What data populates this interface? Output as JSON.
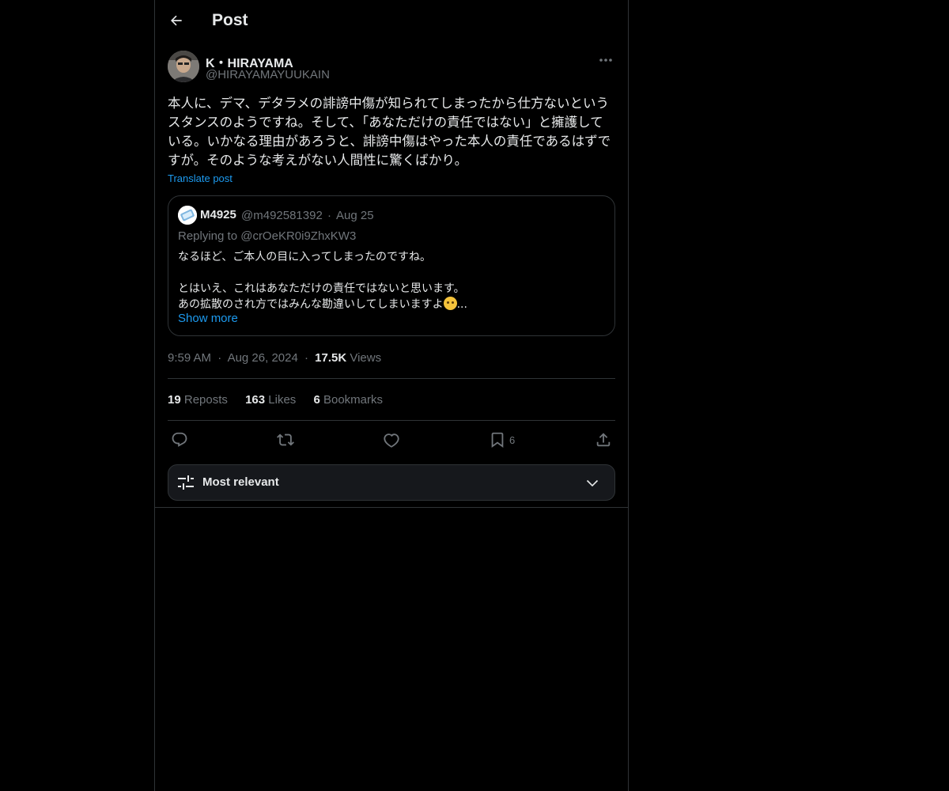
{
  "header": {
    "title": "Post"
  },
  "post": {
    "author_name": "K・HIRAYAMA",
    "author_handle": "@HIRAYAMAYUUKAIN",
    "text": "本人に、デマ、デタラメの誹謗中傷が知られてしまったから仕方ないというスタンスのようですね。そして、「あなただけの責任ではない」と擁護している。いかなる理由があろうと、誹謗中傷はやった本人の責任であるはずですが。そのような考えがない人間性に驚くばかり。",
    "translate_label": "Translate post",
    "time": "9:59 AM",
    "date": "Aug 26, 2024",
    "views_count": "17.5K",
    "views_label": "Views",
    "separator": "·"
  },
  "quote": {
    "name": "M4925",
    "handle": "@m492581392",
    "separator": "·",
    "date": "Aug 25",
    "replying_to": "Replying to @crOeKR0i9ZhxKW3",
    "line1": "なるほど、ご本人の目に入ってしまったのですね。",
    "line2": "とはいえ、これはあなただけの責任ではないと思います。",
    "line3": "あの拡散のされ方ではみんな勘違いしてしまいますよ",
    "line3_tail": "...",
    "show_more": "Show more"
  },
  "stats": {
    "reposts_count": "19",
    "reposts_label": "Reposts",
    "likes_count": "163",
    "likes_label": "Likes",
    "bookmarks_count": "6",
    "bookmarks_label": "Bookmarks"
  },
  "actions": {
    "bookmark_count": "6"
  },
  "sort": {
    "label": "Most relevant"
  },
  "colors": {
    "background": "#000000",
    "text": "#e7e9ea",
    "secondary": "#71767b",
    "accent": "#1d9bf0",
    "border": "#2f3336"
  },
  "icons": {
    "back": "arrow-left-icon",
    "more": "more-horizontal-icon",
    "reply": "reply-icon",
    "repost": "repost-icon",
    "like": "heart-icon",
    "bookmark": "bookmark-icon",
    "share": "share-icon",
    "sort": "sliders-icon",
    "chevron": "chevron-down-icon",
    "emoji": "sad-face-emoji"
  }
}
